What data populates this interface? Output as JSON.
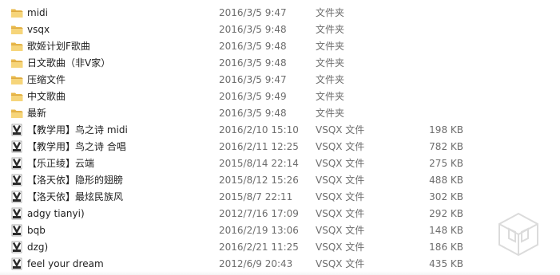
{
  "files": [
    {
      "name": "midi",
      "date": "2016/3/5 9:47",
      "type": "文件夹",
      "size": "",
      "icon": "folder-icon"
    },
    {
      "name": "vsqx",
      "date": "2016/3/5 9:48",
      "type": "文件夹",
      "size": "",
      "icon": "folder-icon"
    },
    {
      "name": "歌姬计划F歌曲",
      "date": "2016/3/5 9:48",
      "type": "文件夹",
      "size": "",
      "icon": "folder-icon"
    },
    {
      "name": "日文歌曲（非V家）",
      "date": "2016/3/5 9:48",
      "type": "文件夹",
      "size": "",
      "icon": "folder-icon"
    },
    {
      "name": "压缩文件",
      "date": "2016/3/5 9:47",
      "type": "文件夹",
      "size": "",
      "icon": "folder-icon"
    },
    {
      "name": "中文歌曲",
      "date": "2016/3/5 9:49",
      "type": "文件夹",
      "size": "",
      "icon": "folder-icon"
    },
    {
      "name": "最新",
      "date": "2016/3/5 9:48",
      "type": "文件夹",
      "size": "",
      "icon": "folder-icon"
    },
    {
      "name": "【教学用】鸟之诗 midi",
      "date": "2016/2/10 15:10",
      "type": "VSQX 文件",
      "size": "198 KB",
      "icon": "vsqx-file-icon"
    },
    {
      "name": "【教学用】鸟之诗 合唱",
      "date": "2016/2/11 12:25",
      "type": "VSQX 文件",
      "size": "782 KB",
      "icon": "vsqx-file-icon"
    },
    {
      "name": "【乐正绫】云端",
      "date": "2015/8/14 22:14",
      "type": "VSQX 文件",
      "size": "275 KB",
      "icon": "vsqx-file-icon"
    },
    {
      "name": "【洛天依】隐形的翅膀",
      "date": "2015/8/12 15:26",
      "type": "VSQX 文件",
      "size": "488 KB",
      "icon": "vsqx-file-icon"
    },
    {
      "name": "【洛天依】最炫民族风",
      "date": "2015/8/7 22:11",
      "type": "VSQX 文件",
      "size": "302 KB",
      "icon": "vsqx-file-icon"
    },
    {
      "name": "adgy tianyi)",
      "date": "2012/7/16 17:09",
      "type": "VSQX 文件",
      "size": "292 KB",
      "icon": "vsqx-file-icon"
    },
    {
      "name": "bqb",
      "date": "2016/2/19 13:06",
      "type": "VSQX 文件",
      "size": "148 KB",
      "icon": "vsqx-file-icon"
    },
    {
      "name": "dzg)",
      "date": "2016/2/21 11:25",
      "type": "VSQX 文件",
      "size": "186 KB",
      "icon": "vsqx-file-icon"
    },
    {
      "name": "feel your dream",
      "date": "2012/6/9 20:43",
      "type": "VSQX 文件",
      "size": "435 KB",
      "icon": "vsqx-file-icon"
    }
  ],
  "colors": {
    "folder_body": "#e8b84a",
    "folder_front": "#f6d57a",
    "vsqx_icon": "#2a2a2a",
    "secondary_text": "#6d6d6d"
  }
}
